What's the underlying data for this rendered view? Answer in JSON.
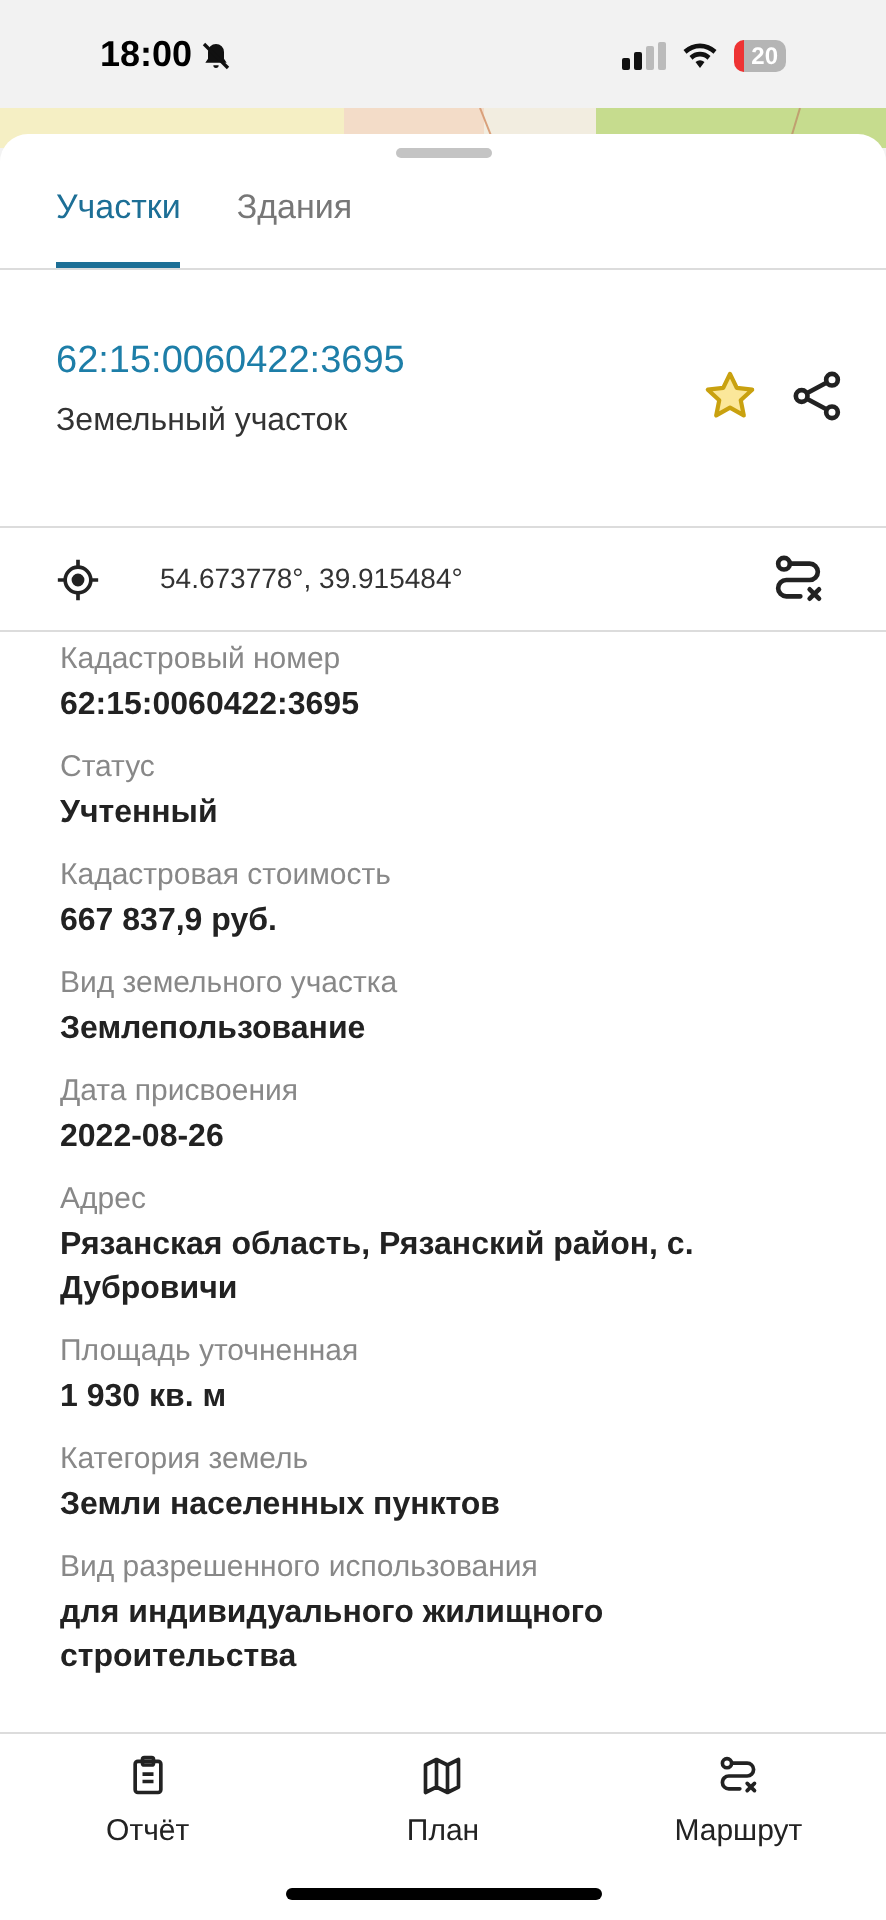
{
  "status_bar": {
    "time": "18:00",
    "battery": "20"
  },
  "tabs": [
    {
      "label": "Участки",
      "selected": true
    },
    {
      "label": "Здания",
      "selected": false
    }
  ],
  "header": {
    "title": "62:15:0060422:3695",
    "subtitle": "Земельный участок"
  },
  "coordinates": "54.673778°, 39.915484°",
  "fields": [
    {
      "label": "Кадастровый номер",
      "value": "62:15:0060422:3695"
    },
    {
      "label": "Статус",
      "value": "Учтенный"
    },
    {
      "label": "Кадастровая стоимость",
      "value": "667 837,9 руб."
    },
    {
      "label": "Вид земельного участка",
      "value": "Землепользование"
    },
    {
      "label": "Дата присвоения",
      "value": "2022-08-26"
    },
    {
      "label": "Адрес",
      "value": "Рязанская область, Рязанский район, с. Дубровичи"
    },
    {
      "label": "Площадь уточненная",
      "value": "1 930 кв. м"
    },
    {
      "label": "Категория земель",
      "value": "Земли населенных пунктов"
    },
    {
      "label": "Вид разрешенного использования",
      "value": "для индивидуального жилищного строительства"
    }
  ],
  "bottom_nav": [
    {
      "label": "Отчёт",
      "kind": "report"
    },
    {
      "label": "План",
      "kind": "map"
    },
    {
      "label": "Маршрут",
      "kind": "route"
    }
  ]
}
